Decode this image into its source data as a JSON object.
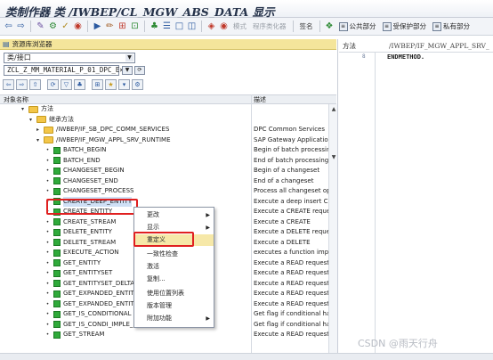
{
  "window": {
    "title": "类制作器 类 /IWBEP/CL_MGW_ABS_DATA 显示"
  },
  "toolbar": {
    "mode_label": "模式",
    "class_optimizer_label": "程序类化器",
    "signature_label": "签名",
    "public_section_label": "公共部分",
    "protected_section_label": "受保护部分",
    "private_section_label": "私有部分"
  },
  "repository": {
    "header": "资源库浏览器",
    "object_type": "类/接口",
    "object_name": "ZCL_Z_MM_MATERIAL_P_01_DPC_E×"
  },
  "columns": {
    "name": "对象名称",
    "description": "描述"
  },
  "tree": [
    {
      "level": 1,
      "type": "folder",
      "expanded": true,
      "label": "方法",
      "desc": ""
    },
    {
      "level": 2,
      "type": "folder",
      "expanded": true,
      "label": "继承方法",
      "desc": ""
    },
    {
      "level": 3,
      "type": "folder",
      "expanded": false,
      "label": "/IWBEP/IF_SB_DPC_COMM_SERVICES",
      "desc": "DPC Common Services"
    },
    {
      "level": 3,
      "type": "folder",
      "expanded": true,
      "label": "/IWBEP/IF_MGW_APPL_SRV_RUNTIME",
      "desc": "SAP Gateway Application I"
    },
    {
      "level": 4,
      "type": "method",
      "label": "BATCH_BEGIN",
      "desc": "Begin of batch processing"
    },
    {
      "level": 4,
      "type": "method",
      "label": "BATCH_END",
      "desc": "End of batch processing"
    },
    {
      "level": 4,
      "type": "method",
      "label": "CHANGESET_BEGIN",
      "desc": "Begin of a changeset"
    },
    {
      "level": 4,
      "type": "method",
      "label": "CHANGESET_END",
      "desc": "End of a changeset"
    },
    {
      "level": 4,
      "type": "method",
      "label": "CHANGESET_PROCESS",
      "desc": "Process all changeset ope"
    },
    {
      "level": 4,
      "type": "method",
      "label": "CREATE_DEEP_ENTITY",
      "desc": "Execute a deep insert CR",
      "selected": true
    },
    {
      "level": 4,
      "type": "method",
      "label": "CREATE_ENTITY",
      "desc": "Execute a CREATE reques"
    },
    {
      "level": 4,
      "type": "method",
      "label": "CREATE_STREAM",
      "desc": "Execute a CREATE"
    },
    {
      "level": 4,
      "type": "method",
      "label": "DELETE_ENTITY",
      "desc": "Execute a DELETE reques"
    },
    {
      "level": 4,
      "type": "method",
      "label": "DELETE_STREAM",
      "desc": "Execute a DELETE"
    },
    {
      "level": 4,
      "type": "method",
      "label": "EXECUTE_ACTION",
      "desc": "executes a function impor"
    },
    {
      "level": 4,
      "type": "method",
      "label": "GET_ENTITY",
      "desc": "Execute a READ request"
    },
    {
      "level": 4,
      "type": "method",
      "label": "GET_ENTITYSET",
      "desc": "Execute a READ request"
    },
    {
      "level": 4,
      "type": "method",
      "label": "GET_ENTITYSET_DELTA",
      "desc": "Execute a READ request"
    },
    {
      "level": 4,
      "type": "method",
      "label": "GET_EXPANDED_ENTITY",
      "desc": "Execute a READ request"
    },
    {
      "level": 4,
      "type": "method",
      "label": "GET_EXPANDED_ENTITY",
      "desc": "Execute a READ request"
    },
    {
      "level": 4,
      "type": "method",
      "label": "GET_IS_CONDITIONAL",
      "desc": "Get flag if conditional hanc"
    },
    {
      "level": 4,
      "type": "method",
      "label": "GET_IS_CONDI_IMPLE_FOR_ACTION",
      "desc": "Get flag if conditional hanc"
    },
    {
      "level": 4,
      "type": "method",
      "label": "GET_STREAM",
      "desc": "Execute a READ request"
    }
  ],
  "context_menu": {
    "items": [
      {
        "label": "更改",
        "submenu": true
      },
      {
        "label": "显示",
        "submenu": true
      },
      {
        "label": "重定义",
        "submenu": false,
        "active": true
      },
      {
        "label": "一致性检查",
        "submenu": false
      },
      {
        "label": "激活",
        "submenu": false
      },
      {
        "label": "复制...",
        "submenu": false
      },
      {
        "label": "使用位置列表",
        "submenu": false
      },
      {
        "label": "版本管理",
        "submenu": false
      },
      {
        "label": "附加功能",
        "submenu": true
      }
    ]
  },
  "editor": {
    "method_label": "方法",
    "method_value": "/IWBEP/IF_MGW_APPL_SRV_",
    "line_number": "8",
    "code": "ENDMETHOD."
  },
  "watermark": "CSDN @雨天行舟",
  "colors": {
    "repo_header": "#f4e59b",
    "menu_active": "#f6e8a8",
    "highlight": "#e02020",
    "method_icon": "#2faa3a"
  }
}
